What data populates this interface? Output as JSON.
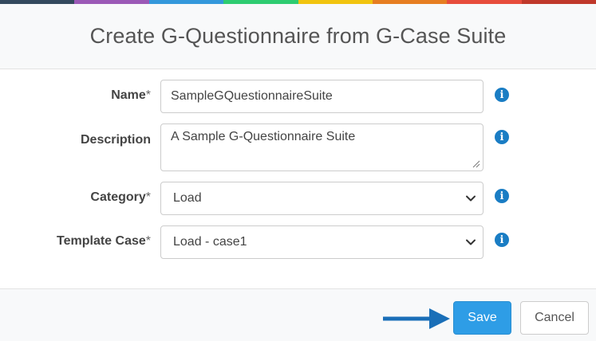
{
  "color_bar": {
    "colors": [
      "#34495e",
      "#9b59b6",
      "#3498db",
      "#2ecc71",
      "#f1c40f",
      "#e67e22",
      "#e74c3c",
      "#c0392b"
    ]
  },
  "dialog": {
    "title": "Create G-Questionnaire from G-Case Suite"
  },
  "form": {
    "name": {
      "label": "Name",
      "required_marker": "*",
      "value": "SampleGQuestionnaireSuite",
      "info_icon": "info-circle-icon"
    },
    "description": {
      "label": "Description",
      "value": "A Sample G-Questionnaire Suite",
      "info_icon": "info-circle-icon"
    },
    "category": {
      "label": "Category",
      "required_marker": "*",
      "selected": "Load",
      "info_icon": "info-circle-icon"
    },
    "template_case": {
      "label": "Template Case",
      "required_marker": "*",
      "selected": "Load - case1",
      "info_icon": "info-circle-icon"
    }
  },
  "footer": {
    "save_label": "Save",
    "cancel_label": "Cancel",
    "save_color": "#2e9de6",
    "arrow_color": "#1a6fb8"
  }
}
